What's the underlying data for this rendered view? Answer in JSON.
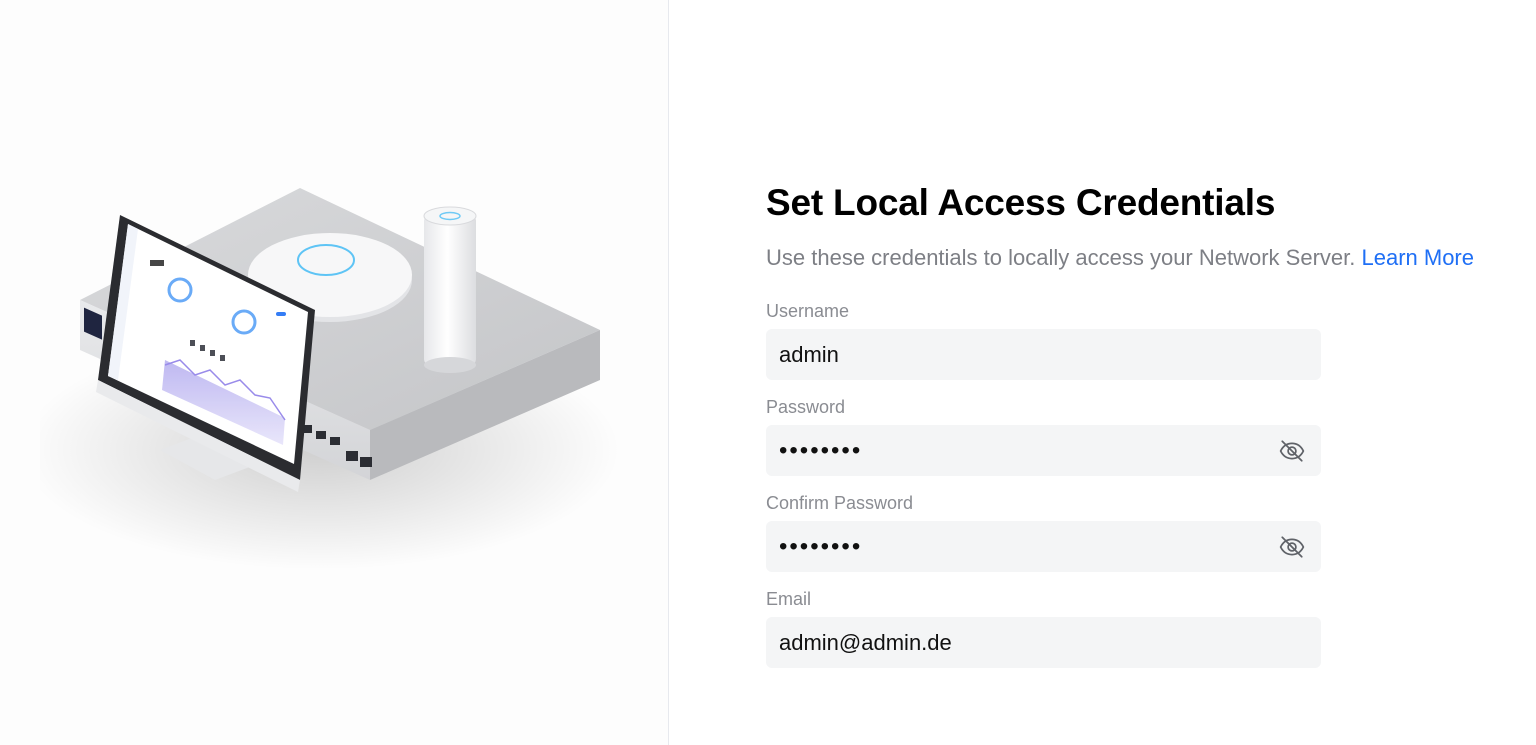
{
  "header": {
    "title": "Set Local Access Credentials",
    "subtitle": "Use these credentials to locally access your Network Server.",
    "learn_more": "Learn More"
  },
  "form": {
    "username": {
      "label": "Username",
      "value": "admin"
    },
    "password": {
      "label": "Password",
      "value": "••••••••",
      "toggle_icon": "eye-off-icon"
    },
    "confirm_password": {
      "label": "Confirm Password",
      "value": "••••••••",
      "toggle_icon": "eye-off-icon"
    },
    "email": {
      "label": "Email",
      "value": "admin@admin.de"
    }
  },
  "colors": {
    "accent": "#1f6ff5",
    "input_bg": "#f4f5f6",
    "label": "#8a8c92",
    "subtitle": "#7d7f85"
  }
}
